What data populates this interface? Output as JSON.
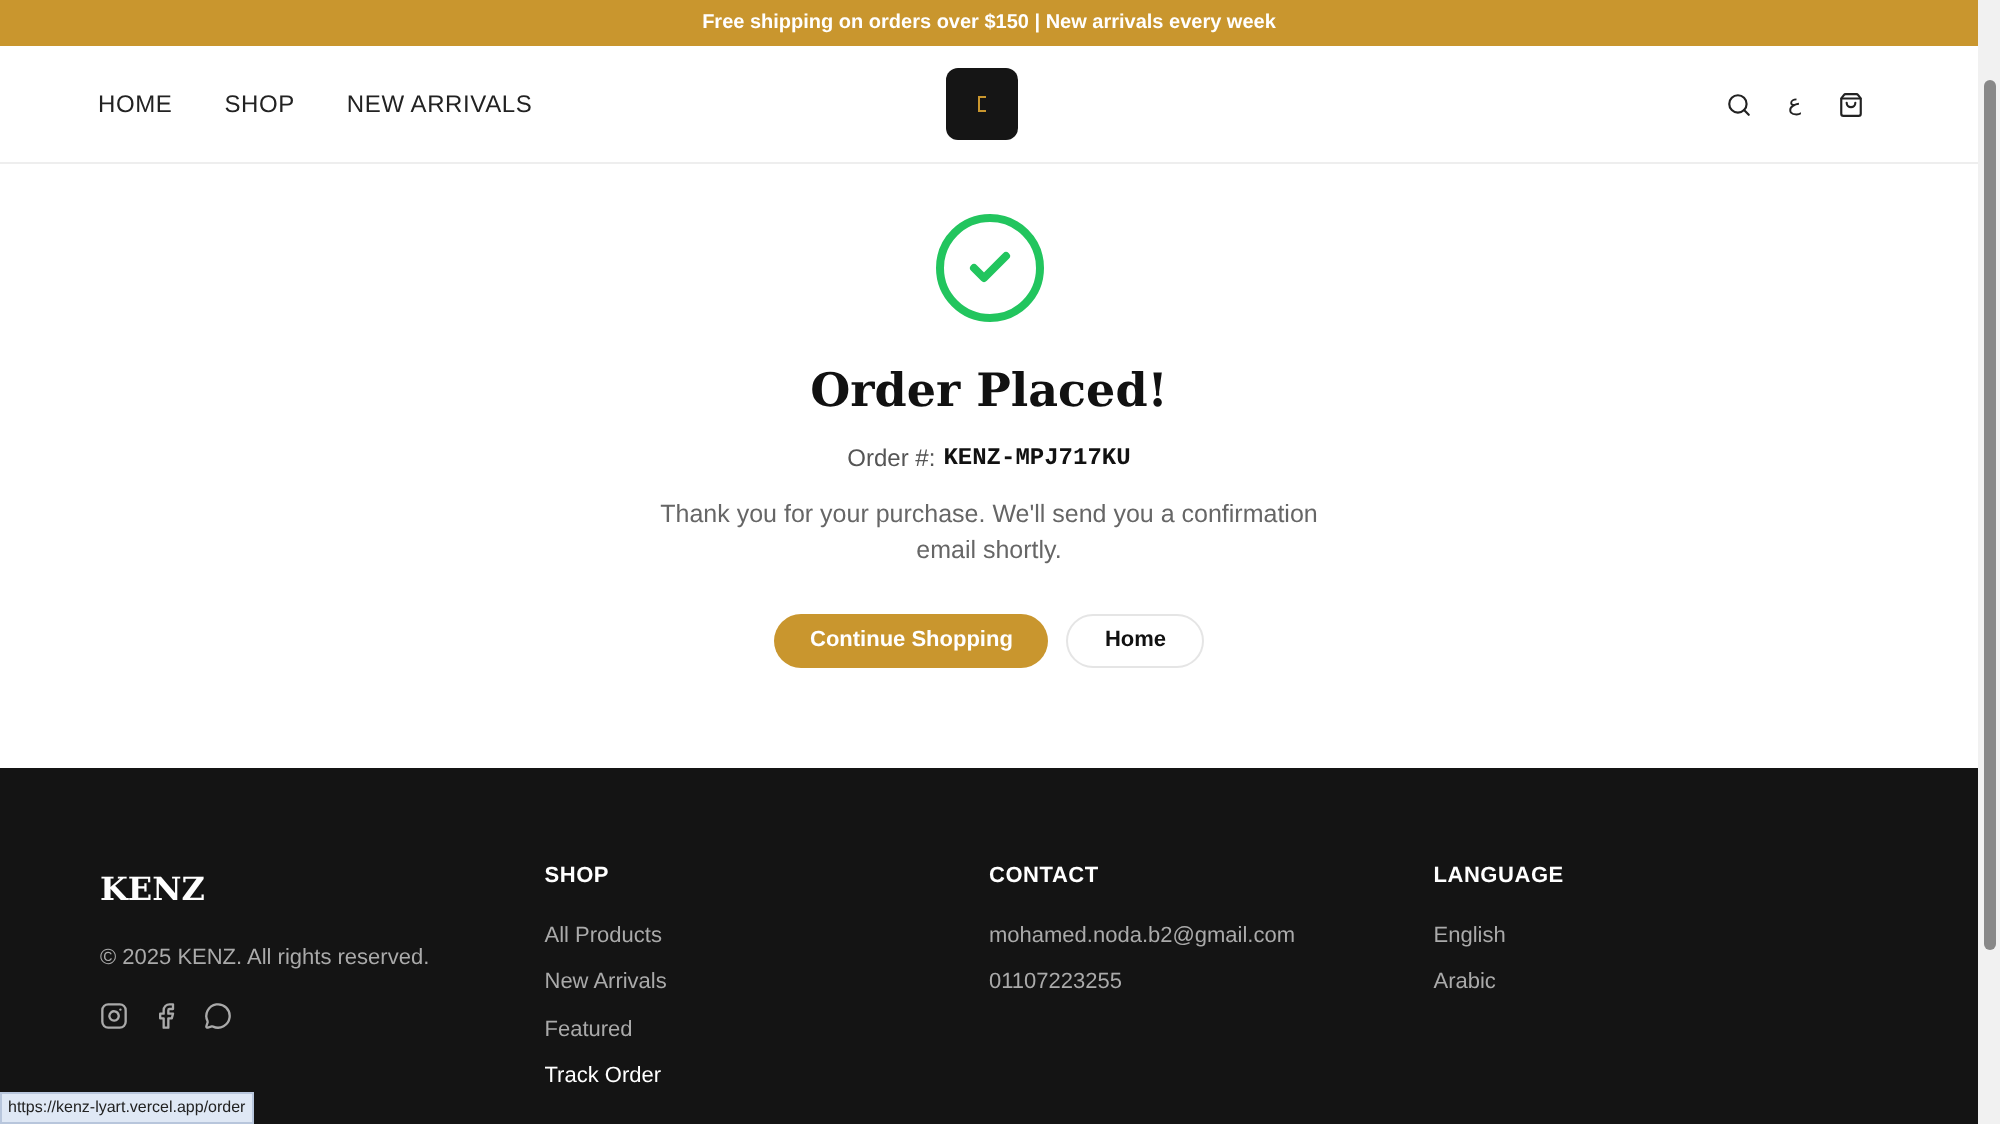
{
  "announcement": "Free shipping on orders over $150 | New arrivals every week",
  "nav": {
    "links": [
      "HOME",
      "SHOP",
      "NEW ARRIVALS"
    ],
    "language_toggle": "ع"
  },
  "confirmation": {
    "title": "Order Placed!",
    "order_label": "Order #:",
    "order_number": "KENZ-MPJ717KU",
    "message": "Thank you for your purchase. We'll send you a confirmation email shortly.",
    "buttons": [
      {
        "label": "Continue Shopping",
        "kind": "primary"
      },
      {
        "label": "Home",
        "kind": "secondary"
      }
    ]
  },
  "footer": {
    "brand": "KENZ",
    "copyright": "© 2025 KENZ. All rights reserved.",
    "columns": [
      {
        "heading": "SHOP",
        "links": [
          {
            "label": "All Products",
            "highlighted": false
          },
          {
            "label": "New Arrivals",
            "highlighted": false
          },
          {
            "label": "Featured",
            "highlighted": false
          },
          {
            "label": "Track Order",
            "highlighted": true
          }
        ]
      },
      {
        "heading": "CONTACT",
        "links": [
          {
            "label": "mohamed.noda.b2@gmail.com",
            "highlighted": false
          },
          {
            "label": "01107223255",
            "highlighted": false
          }
        ]
      },
      {
        "heading": "LANGUAGE",
        "links": [
          {
            "label": "English",
            "highlighted": false
          },
          {
            "label": "Arabic",
            "highlighted": false
          }
        ]
      }
    ]
  },
  "status_bar": {
    "url": "https://kenz-lyart.vercel.app/order"
  }
}
